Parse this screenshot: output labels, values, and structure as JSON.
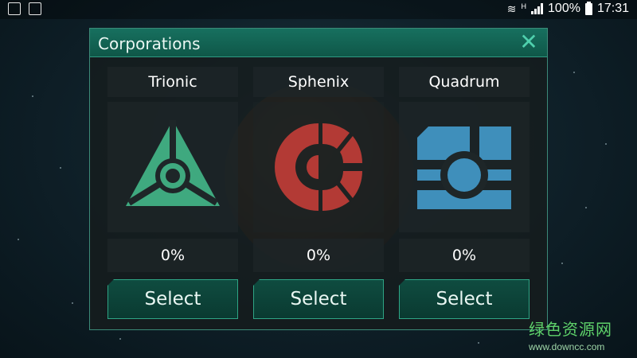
{
  "status_bar": {
    "battery": "100%",
    "time": "17:31",
    "network_letter": "H"
  },
  "dialog": {
    "title": "Corporations",
    "corporations": [
      {
        "name": "Trionic",
        "progress": "0%",
        "select_label": "Select",
        "icon": "trionic-logo-icon",
        "color": "#3fa97f"
      },
      {
        "name": "Sphenix",
        "progress": "0%",
        "select_label": "Select",
        "icon": "sphenix-logo-icon",
        "color": "#b33a35"
      },
      {
        "name": "Quadrum",
        "progress": "0%",
        "select_label": "Select",
        "icon": "quadrum-logo-icon",
        "color": "#3f8fbb"
      }
    ]
  },
  "watermark": {
    "text_cn": "绿色资源网",
    "url": "www.downcc.com"
  }
}
